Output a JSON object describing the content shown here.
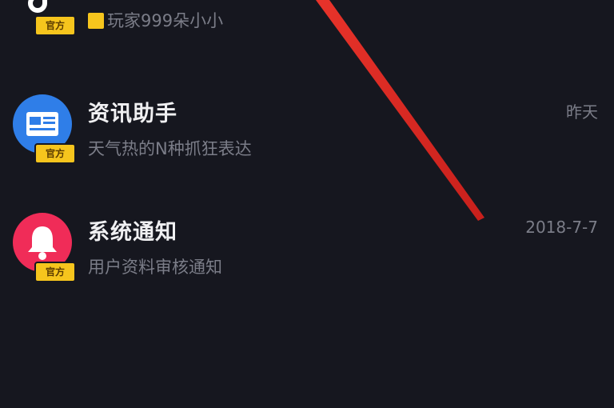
{
  "messages": [
    {
      "title": "",
      "subtitle": "玩家999朵小小",
      "time": "",
      "badge": "官方",
      "icon": "tiktok-logo-icon",
      "icon_color": "#16171f"
    },
    {
      "title": "资讯助手",
      "subtitle": "天气热的N种抓狂表达",
      "time": "昨天",
      "badge": "官方",
      "icon": "news-card-icon",
      "icon_color": "#2f7ee8"
    },
    {
      "title": "系统通知",
      "subtitle": "用户资料审核通知",
      "time": "2018-7-7",
      "badge": "官方",
      "icon": "bell-icon",
      "icon_color": "#f02c58"
    }
  ],
  "annotation": {
    "arrow_color": "#e8332a"
  },
  "colors": {
    "background": "#16171f",
    "badge": "#f6c51d",
    "title": "#f0f0f2",
    "secondary_text": "#7b7d88"
  }
}
